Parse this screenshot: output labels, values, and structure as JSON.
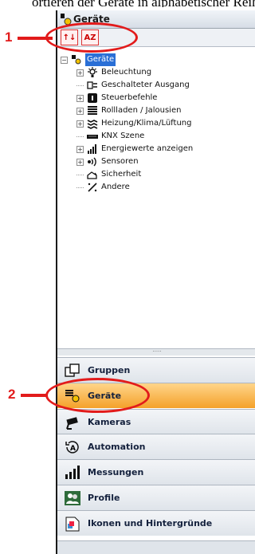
{
  "heading": "ortieren der Geräte in alphabetischer Reihenfolge",
  "panel": {
    "title": "Geräte",
    "toolbar": {
      "btn1": "↑↓",
      "btn2": "AZ"
    },
    "tree_root": "Geräte",
    "tree": [
      {
        "label": "Beleuchtung",
        "icon": "light-bulb-icon",
        "expandable": true
      },
      {
        "label": "Geschalteter Ausgang",
        "icon": "switch-output-icon",
        "expandable": false
      },
      {
        "label": "Steuerbefehle",
        "icon": "control-command-icon",
        "expandable": true
      },
      {
        "label": "Rollladen / Jalousien",
        "icon": "shutter-icon",
        "expandable": true
      },
      {
        "label": "Heizung/Klima/Lüftung",
        "icon": "hvac-icon",
        "expandable": true
      },
      {
        "label": "KNX Szene",
        "icon": "scene-icon",
        "expandable": false
      },
      {
        "label": "Energiewerte anzeigen",
        "icon": "energy-icon",
        "expandable": true
      },
      {
        "label": "Sensoren",
        "icon": "sensor-icon",
        "expandable": true
      },
      {
        "label": "Sicherheit",
        "icon": "security-icon",
        "expandable": false
      },
      {
        "label": "Andere",
        "icon": "other-icon",
        "expandable": false
      }
    ],
    "nav": [
      {
        "label": "Gruppen",
        "icon": "groups-icon",
        "active": false
      },
      {
        "label": "Geräte",
        "icon": "devices-icon",
        "active": true
      },
      {
        "label": "Kameras",
        "icon": "camera-icon",
        "active": false
      },
      {
        "label": "Automation",
        "icon": "automation-icon",
        "active": false
      },
      {
        "label": "Messungen",
        "icon": "measurements-icon",
        "active": false
      },
      {
        "label": "Profile",
        "icon": "profiles-icon",
        "active": false
      },
      {
        "label": "Ikonen und Hintergründe",
        "icon": "icons-backgrounds-icon",
        "active": false
      }
    ]
  },
  "callouts": {
    "one": "1",
    "two": "2"
  },
  "colors": {
    "callout": "#e21b1b",
    "active_nav": "#f4a12a",
    "tree_selected": "#2a6fd6"
  }
}
